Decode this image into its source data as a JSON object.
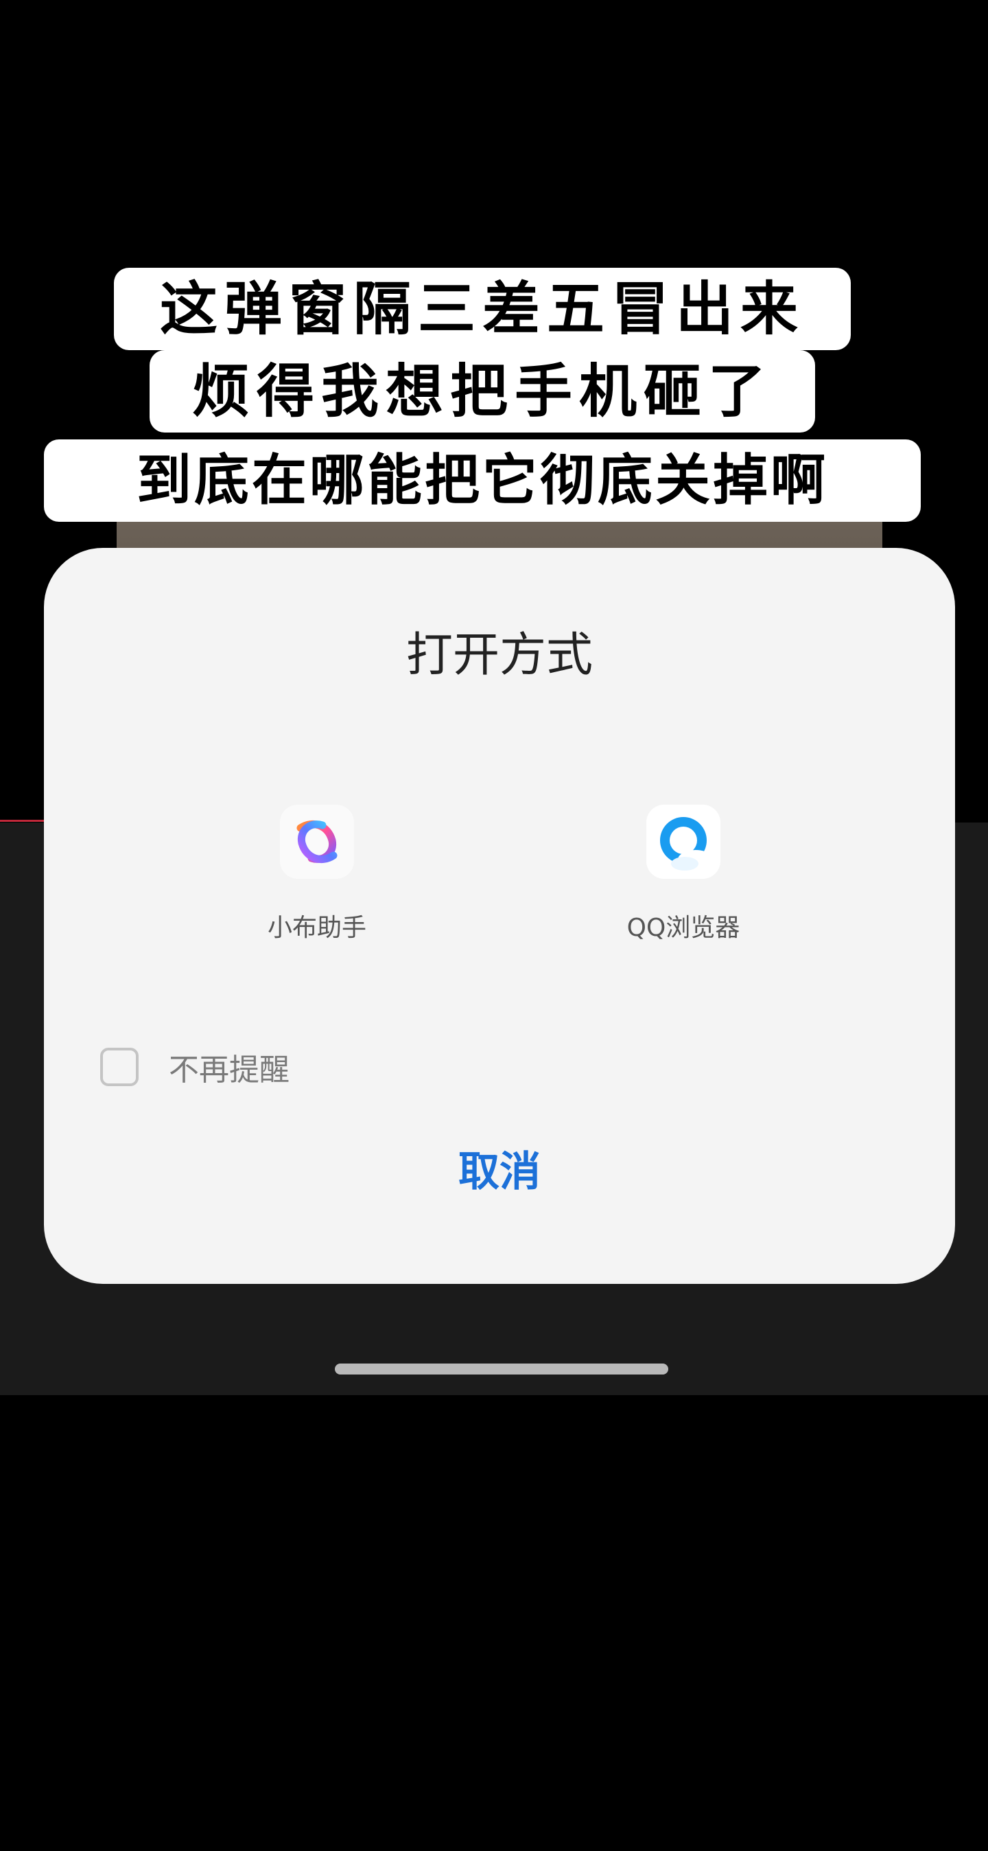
{
  "caption": {
    "line1": "这弹窗隔三差五冒出来",
    "line2": "烦得我想把手机砸了",
    "line3": "到底在哪能把它彻底关掉啊"
  },
  "dialog": {
    "title": "打开方式",
    "apps": [
      {
        "label": "小布助手",
        "icon": "xiaobu-assistant-icon"
      },
      {
        "label": "QQ浏览器",
        "icon": "qq-browser-icon"
      }
    ],
    "remember_label": "不再提醒",
    "remember_checked": false,
    "cancel_label": "取消"
  },
  "colors": {
    "dialog_bg": "#f4f4f4",
    "cancel_text": "#1c70d8",
    "qq_browser_blue": "#1a9cf0"
  }
}
